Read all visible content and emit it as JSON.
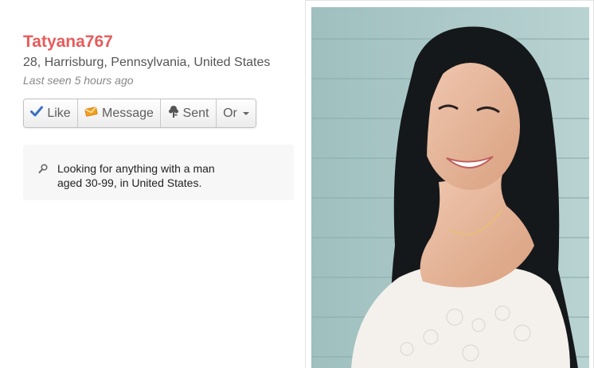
{
  "profile": {
    "username": "Tatyana767",
    "details": "28, Harrisburg, Pennsylvania, United States",
    "last_seen": "Last seen 5 hours ago"
  },
  "actions": {
    "like_label": "Like",
    "message_label": "Message",
    "sent_label": "Sent",
    "or_label": "Or"
  },
  "looking_for": {
    "line1": "Looking for anything with a man",
    "line2": "aged 30-99, in United States."
  },
  "icons": {
    "like": "checkmark-icon",
    "message": "envelope-icon",
    "sent": "flower-icon",
    "or": "caret-down-icon",
    "search": "search-icon"
  },
  "colors": {
    "username": "#e65c5c",
    "like_icon": "#3b6fc4",
    "message_icon": "#f0a020"
  }
}
